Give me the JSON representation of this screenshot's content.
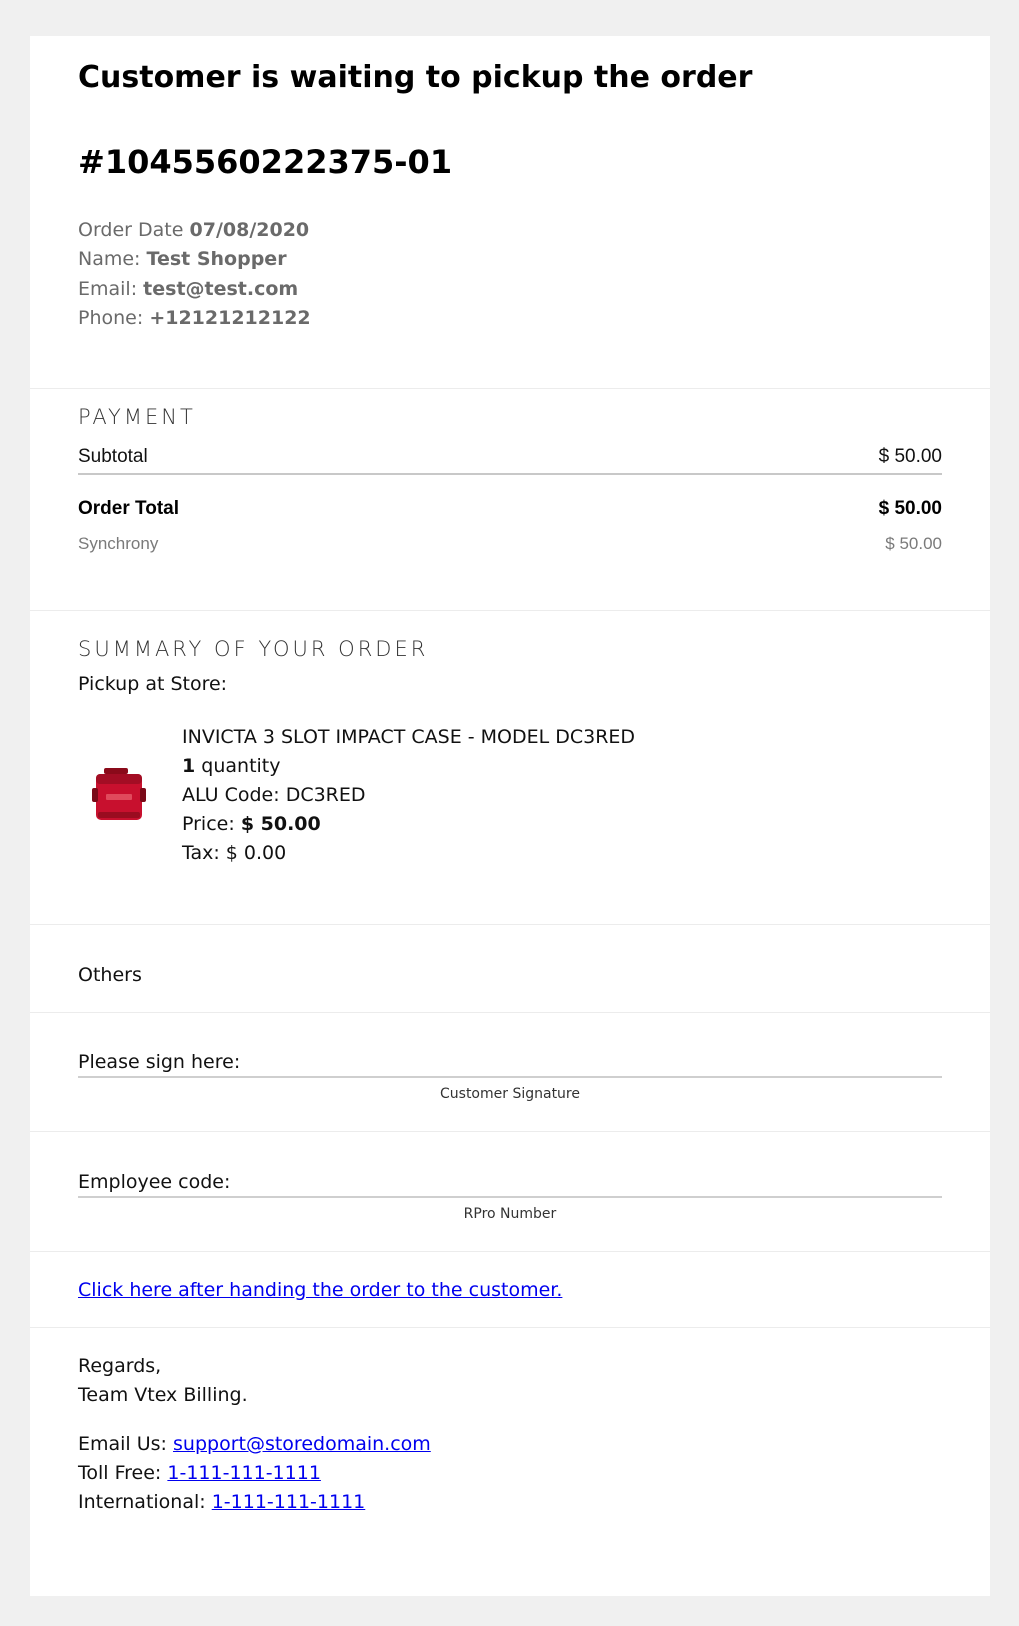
{
  "header": {
    "title": "Customer is waiting to pickup the order",
    "order_number": "#1045560222375-01",
    "order_date_label": "Order Date",
    "order_date": "07/08/2020",
    "name_label": "Name:",
    "name": "Test Shopper",
    "email_label": "Email:",
    "email": "test@test.com",
    "phone_label": "Phone:",
    "phone": "+12121212122"
  },
  "payment": {
    "heading": "PAYMENT",
    "subtotal_label": "Subtotal",
    "subtotal_value": "$ 50.00",
    "total_label": "Order Total",
    "total_value": "$ 50.00",
    "method_label": "Synchrony",
    "method_value": "$ 50.00"
  },
  "summary": {
    "heading": "SUMMARY OF YOUR ORDER",
    "pickup_label": "Pickup at Store:",
    "item": {
      "name": "INVICTA 3 SLOT IMPACT CASE - MODEL DC3RED",
      "quantity": "1",
      "quantity_suffix": "quantity",
      "alu_label": "ALU Code:",
      "alu_code": "DC3RED",
      "price_label": "Price:",
      "price": "$ 50.00",
      "tax_label": "Tax:",
      "tax": "$ 0.00",
      "image_icon": "red-impact-case-image",
      "image_color": "#c8102e"
    }
  },
  "others": {
    "label": "Others"
  },
  "signature": {
    "label": "Please sign here:",
    "caption": "Customer Signature"
  },
  "employee": {
    "label": "Employee code:",
    "caption": "RPro Number"
  },
  "handoff": {
    "link_text": "Click here after handing the order to the customer."
  },
  "footer": {
    "regards": "Regards,",
    "team": "Team Vtex Billing.",
    "email_label": "Email Us:",
    "email_link": "support@storedomain.com",
    "tollfree_label": "Toll Free:",
    "tollfree_link": "1-111-111-1111",
    "international_label": "International:",
    "international_link": "1-111-111-1111"
  },
  "colors": {
    "page_background": "#f0f0f0",
    "card_background": "#ffffff",
    "link": "#0000ee",
    "muted_text": "#6a6a6a"
  }
}
